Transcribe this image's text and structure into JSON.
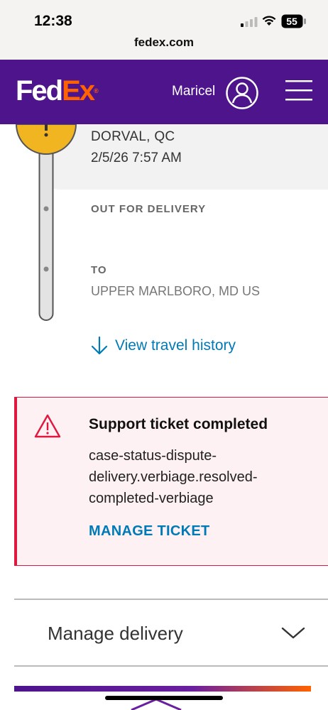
{
  "status_bar": {
    "time": "12:38",
    "battery": "55",
    "domain": "fedex.com"
  },
  "header": {
    "logo_fed": "Fed",
    "logo_ex": "Ex",
    "logo_reg": "®",
    "user_name": "Maricel",
    "icons": [
      "user-icon",
      "menu-icon"
    ],
    "colors": {
      "brand_purple": "#4d148c",
      "brand_orange": "#ff6200"
    }
  },
  "tracking": {
    "from_city": "DORVAL, QC",
    "from_time": "2/5/26 7:57 AM",
    "status": "OUT FOR DELIVERY",
    "to_label": "TO",
    "to_city": "UPPER MARLBORO, MD US",
    "history_link": "View travel history",
    "colors": {
      "exception_marker": "#f1b522",
      "link": "#007ab7"
    }
  },
  "alert": {
    "title": "Support ticket completed",
    "body": "case-status-dispute-delivery.verbiage.resolved-completed-verbiage",
    "action": "MANAGE TICKET",
    "icon": "warning-triangle-icon",
    "colors": {
      "border": "#e0173f"
    }
  },
  "manage_delivery": {
    "label": "Manage delivery",
    "icon": "chevron-down-icon"
  }
}
